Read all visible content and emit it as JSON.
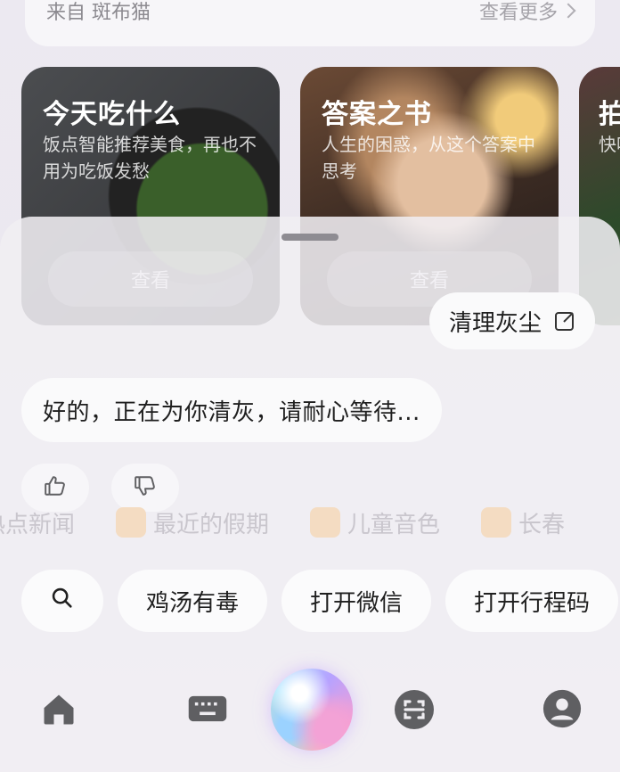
{
  "source_card": {
    "label": "来自 斑布猫",
    "more_label": "查看更多"
  },
  "feature_cards": [
    {
      "title": "今天吃什么",
      "desc": "饭点智能推荐美食，再也不用为吃饭发愁",
      "button": "查看"
    },
    {
      "title": "答案之书",
      "desc": "人生的困惑，从这个答案中思考",
      "button": "查看"
    },
    {
      "title": "拍",
      "desc": "快吃"
    }
  ],
  "conversation": {
    "user_message": "清理灰尘",
    "assistant_message": "好的，正在为你清灰，请耐心等待..."
  },
  "background_suggestions": [
    "热点新闻",
    "最近的假期",
    "儿童音色",
    "长春"
  ],
  "chips": [
    {
      "label": "鸡汤有毒"
    },
    {
      "label": "打开微信"
    },
    {
      "label": "打开行程码"
    }
  ],
  "icons": {
    "search": "search-icon",
    "edit": "edit-icon",
    "thumbs_up": "thumbs-up-icon",
    "thumbs_down": "thumbs-down-icon",
    "home": "home-icon",
    "keyboard": "keyboard-icon",
    "voice": "voice-orb-icon",
    "scan": "scan-icon",
    "profile": "profile-icon"
  },
  "colors": {
    "icon_gray": "#5f5f62",
    "bubble_bg": "#fafafb",
    "sheet_bg": "#f0eef3"
  }
}
